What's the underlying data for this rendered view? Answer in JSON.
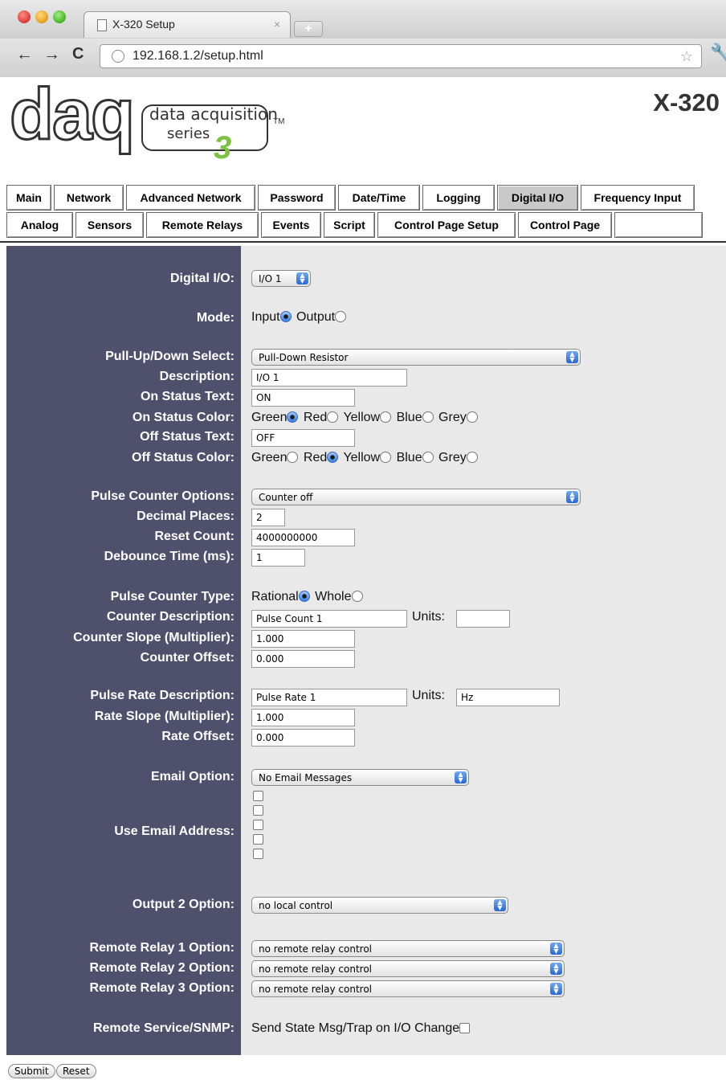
{
  "browser": {
    "tab_title": "X-320 Setup",
    "tab_close": "×",
    "new_tab": "+",
    "url": "192.168.1.2/setup.html"
  },
  "header": {
    "logo_word": "daq",
    "logo_line1": "data acquisition",
    "logo_line2": "series",
    "logo_tm": "TM",
    "logo_number": "3",
    "title": "X-320"
  },
  "nav": {
    "row1": [
      "Main",
      "Network",
      "Advanced Network",
      "Password",
      "Date/Time",
      "Logging",
      "Digital I/O",
      "Frequency Input"
    ],
    "row2": [
      "Analog",
      "Sensors",
      "Remote Relays",
      "Events",
      "Script",
      "Control Page Setup",
      "Control Page",
      ""
    ],
    "active": "Digital I/O"
  },
  "form": {
    "digital_io": {
      "label": "Digital I/O:",
      "value": "I/O 1"
    },
    "mode": {
      "label": "Mode:",
      "options": [
        "Input",
        "Output"
      ],
      "selected": "Input"
    },
    "pull": {
      "label": "Pull-Up/Down Select:",
      "value": "Pull-Down Resistor"
    },
    "description": {
      "label": "Description:",
      "value": "I/O 1"
    },
    "on_text": {
      "label": "On Status Text:",
      "value": "ON"
    },
    "on_color": {
      "label": "On Status Color:",
      "options": [
        "Green",
        "Red",
        "Yellow",
        "Blue",
        "Grey"
      ],
      "selected": "Green"
    },
    "off_text": {
      "label": "Off Status Text:",
      "value": "OFF"
    },
    "off_color": {
      "label": "Off Status Color:",
      "options": [
        "Green",
        "Red",
        "Yellow",
        "Blue",
        "Grey"
      ],
      "selected": "Red"
    },
    "pulse_options": {
      "label": "Pulse Counter Options:",
      "value": "Counter off"
    },
    "decimal_places": {
      "label": "Decimal Places:",
      "value": "2"
    },
    "reset_count": {
      "label": "Reset Count:",
      "value": "4000000000"
    },
    "debounce": {
      "label": "Debounce Time (ms):",
      "value": "1"
    },
    "pulse_type": {
      "label": "Pulse Counter Type:",
      "options": [
        "Rational",
        "Whole"
      ],
      "selected": "Rational"
    },
    "counter_desc": {
      "label": "Counter Description:",
      "value": "Pulse Count 1",
      "units_label": "Units:",
      "units_value": ""
    },
    "counter_slope": {
      "label": "Counter Slope (Multiplier):",
      "value": "1.000"
    },
    "counter_offset": {
      "label": "Counter Offset:",
      "value": "0.000"
    },
    "rate_desc": {
      "label": "Pulse Rate Description:",
      "value": "Pulse Rate 1",
      "units_label": "Units:",
      "units_value": "Hz"
    },
    "rate_slope": {
      "label": "Rate Slope (Multiplier):",
      "value": "1.000"
    },
    "rate_offset": {
      "label": "Rate Offset:",
      "value": "0.000"
    },
    "email_option": {
      "label": "Email Option:",
      "value": "No Email Messages"
    },
    "use_email": {
      "label": "Use Email Address:",
      "count": 5
    },
    "output2": {
      "label": "Output 2 Option:",
      "value": "no local control"
    },
    "relay1": {
      "label": "Remote Relay 1 Option:",
      "value": "no remote relay control"
    },
    "relay2": {
      "label": "Remote Relay 2 Option:",
      "value": "no remote relay control"
    },
    "relay3": {
      "label": "Remote Relay 3 Option:",
      "value": "no remote relay control"
    },
    "snmp": {
      "label": "Remote Service/SNMP:",
      "text": "Send State Msg/Trap on I/O Change"
    }
  },
  "buttons": {
    "submit": "Submit",
    "reset": "Reset"
  },
  "icons": [
    "page-icon",
    "close-icon",
    "back-arrow-icon",
    "forward-arrow-icon",
    "reload-icon",
    "globe-icon",
    "star-icon",
    "wrench-icon",
    "select-arrows-icon"
  ]
}
